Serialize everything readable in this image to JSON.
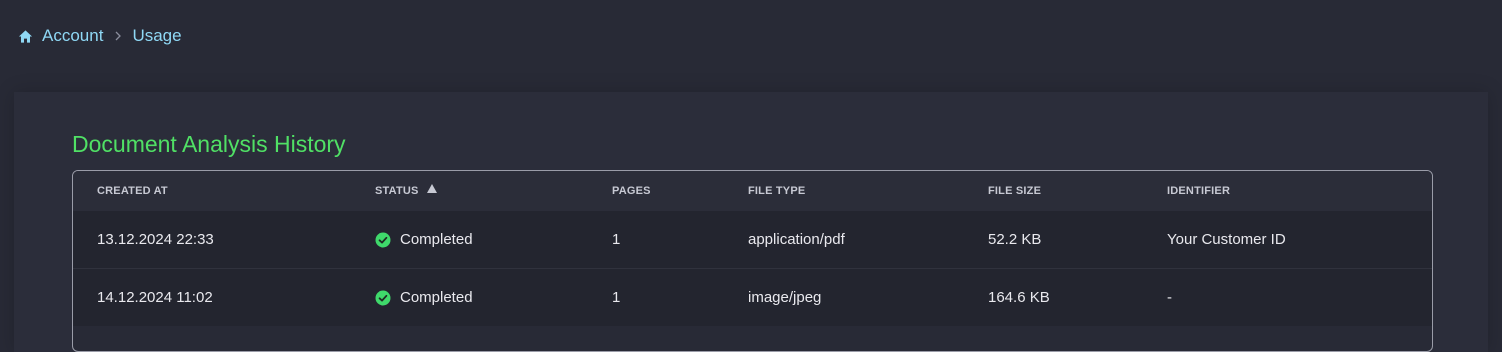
{
  "breadcrumb": {
    "home_icon": "home-icon",
    "items": [
      "Account",
      "Usage"
    ]
  },
  "section": {
    "title": "Document Analysis History"
  },
  "table": {
    "columns": [
      "CREATED AT",
      "STATUS",
      "PAGES",
      "FILE TYPE",
      "FILE SIZE",
      "IDENTIFIER"
    ],
    "sort": {
      "column": "STATUS",
      "direction": "ascending",
      "icon": "sort-up-icon"
    },
    "rows": [
      {
        "created_at": "13.12.2024 22:33",
        "status": "Completed",
        "status_icon": "check-circle-icon",
        "pages": "1",
        "file_type": "application/pdf",
        "file_size": "52.2 KB",
        "identifier": "Your Customer ID"
      },
      {
        "created_at": "14.12.2024 11:02",
        "status": "Completed",
        "status_icon": "check-circle-icon",
        "pages": "1",
        "file_type": "image/jpeg",
        "file_size": "164.6 KB",
        "identifier": "-"
      }
    ]
  },
  "colors": {
    "background": "#282a36",
    "title_green": "#50e065",
    "link_blue": "#8fd8f5",
    "success_green": "#3fd96b"
  }
}
